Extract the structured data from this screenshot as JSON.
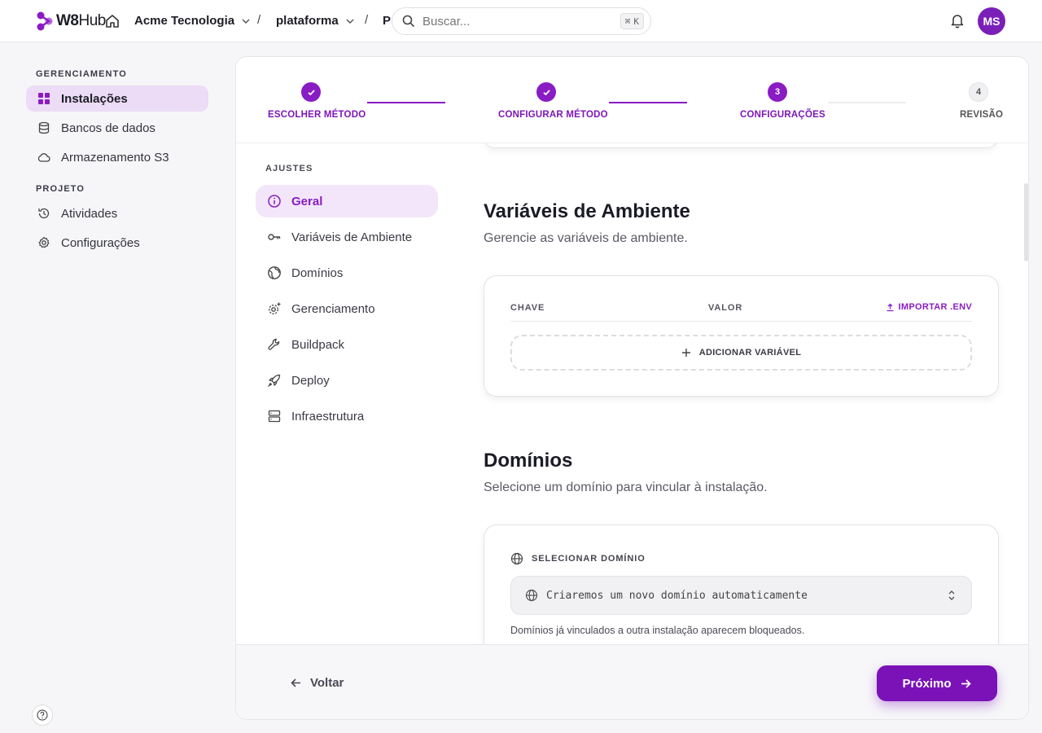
{
  "header": {
    "logo_text_bold": "W8",
    "logo_text_thin": "Hub",
    "org_name": "Acme Tecnologia",
    "separator": "/",
    "project_name": "plataforma",
    "truncated_crumb": "P",
    "search_placeholder": "Buscar...",
    "search_shortcut_mod": "⌘",
    "search_shortcut_key": "K",
    "avatar_initials": "MS"
  },
  "sidebar": {
    "sections": [
      {
        "title": "GERENCIAMENTO",
        "items": [
          {
            "label": "Instalações",
            "icon": "grid-icon",
            "active": true
          },
          {
            "label": "Bancos de dados",
            "icon": "database-icon",
            "active": false
          },
          {
            "label": "Armazenamento S3",
            "icon": "cloud-icon",
            "active": false
          }
        ]
      },
      {
        "title": "PROJETO",
        "items": [
          {
            "label": "Atividades",
            "icon": "history-icon",
            "active": false
          },
          {
            "label": "Configurações",
            "icon": "gear-icon",
            "active": false
          }
        ]
      }
    ]
  },
  "stepper": {
    "steps": [
      {
        "label": "ESCOLHER MÉTODO",
        "state": "done",
        "number": ""
      },
      {
        "label": "CONFIGURAR MÉTODO",
        "state": "done",
        "number": ""
      },
      {
        "label": "CONFIGURAÇÕES",
        "state": "current",
        "number": "3"
      },
      {
        "label": "REVISÃO",
        "state": "todo",
        "number": "4"
      }
    ]
  },
  "settings_menu": {
    "title": "AJUSTES",
    "items": [
      {
        "label": "Geral",
        "icon": "info-icon",
        "active": true
      },
      {
        "label": "Variáveis de Ambiente",
        "icon": "key-icon",
        "active": false
      },
      {
        "label": "Domínios",
        "icon": "globe-icon",
        "active": false
      },
      {
        "label": "Gerenciamento",
        "icon": "cog-sparkle-icon",
        "active": false
      },
      {
        "label": "Buildpack",
        "icon": "wrench-icon",
        "active": false
      },
      {
        "label": "Deploy",
        "icon": "rocket-icon",
        "active": false
      },
      {
        "label": "Infraestrutura",
        "icon": "server-icon",
        "active": false
      }
    ]
  },
  "env_section": {
    "title": "Variáveis de Ambiente",
    "subtitle": "Gerencie as variáveis de ambiente.",
    "col_key": "CHAVE",
    "col_value": "VALOR",
    "import_label": "IMPORTAR .ENV",
    "add_label": "ADICIONAR VARIÁVEL"
  },
  "domain_section": {
    "title": "Domínios",
    "subtitle": "Selecione um domínio para vincular à instalação.",
    "select_label": "SELECIONAR DOMÍNIO",
    "select_value": "Criaremos um novo domínio automaticamente",
    "hint": "Domínios já vinculados a outra instalação aparecem bloqueados."
  },
  "footer": {
    "back_label": "Voltar",
    "next_label": "Próximo"
  },
  "colors": {
    "accent": "#7a12b8",
    "accent_light": "#f3e6fa",
    "sidebar_active": "#ecdcf5"
  }
}
